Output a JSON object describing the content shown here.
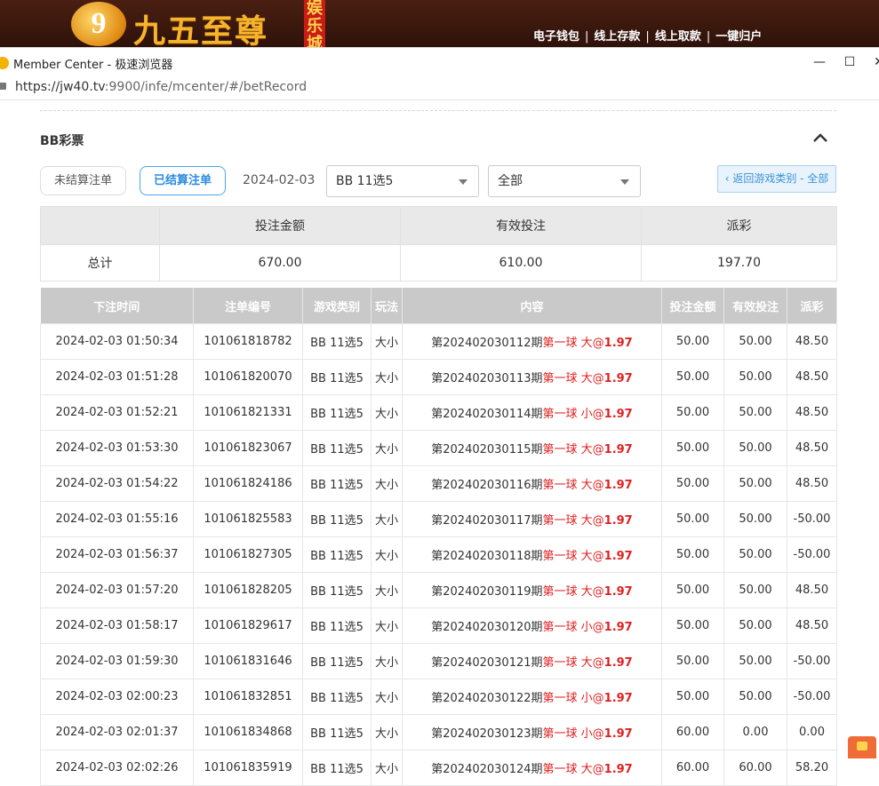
{
  "banner": {
    "logo_mark": "9",
    "logo_text": "九五至尊",
    "logo_tag": "娱乐城",
    "links": [
      "电子钱包",
      "线上存款",
      "线上取款",
      "一键归户"
    ]
  },
  "browser": {
    "title": "Member Center - 极速浏览器",
    "url_host": "https://jw40.tv",
    "url_rest": ":9900/infe/mcenter/#/betRecord",
    "minimize": "—",
    "maximize": "☐",
    "close": "✕"
  },
  "section": {
    "title": "BB彩票"
  },
  "filters": {
    "unsettled_label": "未结算注单",
    "settled_label": "已结算注单",
    "date": "2024-02-03",
    "game_select": "BB 11选5",
    "type_select": "全部",
    "back_label": "‹ 返回游戏类别 - 全部"
  },
  "summary": {
    "headers": [
      "",
      "投注金额",
      "有效投注",
      "派彩"
    ],
    "row_label": "总计",
    "values": [
      "670.00",
      "610.00",
      "197.70"
    ]
  },
  "table": {
    "headers": [
      "下注时间",
      "注单编号",
      "游戏类别",
      "玩法",
      "内容",
      "投注金额",
      "有效投注",
      "派彩"
    ],
    "rows": [
      {
        "time": "2024-02-03 01:50:34",
        "id": "101061818782",
        "game": "BB 11选5",
        "play": "大小",
        "period": "第202402030112期",
        "pick": "第一球 大",
        "odds": "1.97",
        "amount": "50.00",
        "valid": "50.00",
        "payout": "48.50",
        "neg": false
      },
      {
        "time": "2024-02-03 01:51:28",
        "id": "101061820070",
        "game": "BB 11选5",
        "play": "大小",
        "period": "第202402030113期",
        "pick": "第一球 大",
        "odds": "1.97",
        "amount": "50.00",
        "valid": "50.00",
        "payout": "48.50",
        "neg": false
      },
      {
        "time": "2024-02-03 01:52:21",
        "id": "101061821331",
        "game": "BB 11选5",
        "play": "大小",
        "period": "第202402030114期",
        "pick": "第一球 小",
        "odds": "1.97",
        "amount": "50.00",
        "valid": "50.00",
        "payout": "48.50",
        "neg": false
      },
      {
        "time": "2024-02-03 01:53:30",
        "id": "101061823067",
        "game": "BB 11选5",
        "play": "大小",
        "period": "第202402030115期",
        "pick": "第一球 大",
        "odds": "1.97",
        "amount": "50.00",
        "valid": "50.00",
        "payout": "48.50",
        "neg": false
      },
      {
        "time": "2024-02-03 01:54:22",
        "id": "101061824186",
        "game": "BB 11选5",
        "play": "大小",
        "period": "第202402030116期",
        "pick": "第一球 大",
        "odds": "1.97",
        "amount": "50.00",
        "valid": "50.00",
        "payout": "48.50",
        "neg": false
      },
      {
        "time": "2024-02-03 01:55:16",
        "id": "101061825583",
        "game": "BB 11选5",
        "play": "大小",
        "period": "第202402030117期",
        "pick": "第一球 大",
        "odds": "1.97",
        "amount": "50.00",
        "valid": "50.00",
        "payout": "-50.00",
        "neg": true
      },
      {
        "time": "2024-02-03 01:56:37",
        "id": "101061827305",
        "game": "BB 11选5",
        "play": "大小",
        "period": "第202402030118期",
        "pick": "第一球 大",
        "odds": "1.97",
        "amount": "50.00",
        "valid": "50.00",
        "payout": "-50.00",
        "neg": true
      },
      {
        "time": "2024-02-03 01:57:20",
        "id": "101061828205",
        "game": "BB 11选5",
        "play": "大小",
        "period": "第202402030119期",
        "pick": "第一球 大",
        "odds": "1.97",
        "amount": "50.00",
        "valid": "50.00",
        "payout": "48.50",
        "neg": false
      },
      {
        "time": "2024-02-03 01:58:17",
        "id": "101061829617",
        "game": "BB 11选5",
        "play": "大小",
        "period": "第202402030120期",
        "pick": "第一球 小",
        "odds": "1.97",
        "amount": "50.00",
        "valid": "50.00",
        "payout": "48.50",
        "neg": false
      },
      {
        "time": "2024-02-03 01:59:30",
        "id": "101061831646",
        "game": "BB 11选5",
        "play": "大小",
        "period": "第202402030121期",
        "pick": "第一球 大",
        "odds": "1.97",
        "amount": "50.00",
        "valid": "50.00",
        "payout": "-50.00",
        "neg": true
      },
      {
        "time": "2024-02-03 02:00:23",
        "id": "101061832851",
        "game": "BB 11选5",
        "play": "大小",
        "period": "第202402030122期",
        "pick": "第一球 小",
        "odds": "1.97",
        "amount": "50.00",
        "valid": "50.00",
        "payout": "-50.00",
        "neg": true
      },
      {
        "time": "2024-02-03 02:01:37",
        "id": "101061834868",
        "game": "BB 11选5",
        "play": "大小",
        "period": "第202402030123期",
        "pick": "第一球 小",
        "odds": "1.97",
        "amount": "60.00",
        "valid": "0.00",
        "payout": "0.00",
        "neg": false
      },
      {
        "time": "2024-02-03 02:02:26",
        "id": "101061835919",
        "game": "BB 11选5",
        "play": "大小",
        "period": "第202402030124期",
        "pick": "第一球 大",
        "odds": "1.97",
        "amount": "60.00",
        "valid": "60.00",
        "payout": "58.20",
        "neg": false
      }
    ]
  },
  "colors": {
    "accent": "#2a8be0",
    "odds": "#e02020",
    "negative": "#e24a4a",
    "header_bg": "#c9c9c9"
  }
}
